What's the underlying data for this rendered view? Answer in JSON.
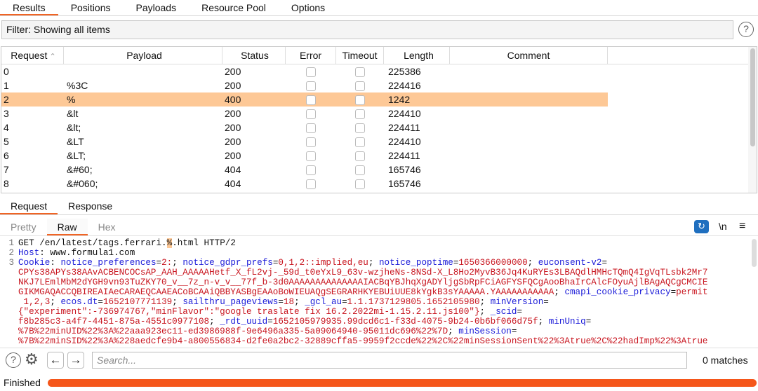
{
  "top_tabs": [
    "Results",
    "Positions",
    "Payloads",
    "Resource Pool",
    "Options"
  ],
  "filter": "Filter: Showing all items",
  "columns": [
    "Request",
    "Payload",
    "Status",
    "Error",
    "Timeout",
    "Length",
    "Comment"
  ],
  "rows": [
    {
      "request": "0",
      "payload": "",
      "status": "200",
      "error": false,
      "timeout": false,
      "length": "225386",
      "comment": ""
    },
    {
      "request": "1",
      "payload": "%3C",
      "status": "200",
      "error": false,
      "timeout": false,
      "length": "224416",
      "comment": ""
    },
    {
      "request": "2",
      "payload": "%",
      "status": "400",
      "error": false,
      "timeout": false,
      "length": "1242",
      "comment": "",
      "selected": true
    },
    {
      "request": "3",
      "payload": "&lt",
      "status": "200",
      "error": false,
      "timeout": false,
      "length": "224410",
      "comment": ""
    },
    {
      "request": "4",
      "payload": "&lt;",
      "status": "200",
      "error": false,
      "timeout": false,
      "length": "224411",
      "comment": ""
    },
    {
      "request": "5",
      "payload": "&LT",
      "status": "200",
      "error": false,
      "timeout": false,
      "length": "224410",
      "comment": ""
    },
    {
      "request": "6",
      "payload": "&LT;",
      "status": "200",
      "error": false,
      "timeout": false,
      "length": "224411",
      "comment": ""
    },
    {
      "request": "7",
      "payload": "&#60;",
      "status": "404",
      "error": false,
      "timeout": false,
      "length": "165746",
      "comment": ""
    },
    {
      "request": "8",
      "payload": "&#060;",
      "status": "404",
      "error": false,
      "timeout": false,
      "length": "165746",
      "comment": ""
    }
  ],
  "detail_tabs": [
    "Request",
    "Response"
  ],
  "view_tabs": [
    "Pretty",
    "Raw",
    "Hex"
  ],
  "toolbar": {
    "newline_label": "\\n",
    "wrap_icon": "wrap-lines-icon",
    "menu_icon": "hamburger-icon"
  },
  "code_lines": [
    {
      "n": "1",
      "segs": [
        [
          "p",
          "GET /en/latest/tags.ferrari."
        ],
        [
          "h",
          "%"
        ],
        [
          "p",
          ".html HTTP/2"
        ]
      ]
    },
    {
      "n": "2",
      "segs": [
        [
          "k",
          "Host"
        ],
        [
          "p",
          ": www.formula1.com"
        ]
      ]
    },
    {
      "n": "3",
      "segs": [
        [
          "k",
          "Cookie"
        ],
        [
          "p",
          ": "
        ],
        [
          "k",
          "notice_preferences"
        ],
        [
          "p",
          "="
        ],
        [
          "v",
          "2:"
        ],
        [
          "p",
          "; "
        ],
        [
          "k",
          "notice_gdpr_prefs"
        ],
        [
          "p",
          "="
        ],
        [
          "v",
          "0,1,2::implied,eu"
        ],
        [
          "p",
          "; "
        ],
        [
          "k",
          "notice_poptime"
        ],
        [
          "p",
          "="
        ],
        [
          "v",
          "1650366000000"
        ],
        [
          "p",
          "; "
        ],
        [
          "k",
          "euconsent-v2"
        ],
        [
          "p",
          "="
        ]
      ]
    },
    {
      "n": "",
      "segs": [
        [
          "v",
          "CPYs38APYs38AAvACBENCOCsAP_AAH_AAAAAHetf_X_fL2vj-_59d_t0eYxL9_63v-wzjheNs-8NSd-X_L8Ho2MyvB36Jq4KuRYEs3LBAQdlHMHcTQmQ4IgVqTLsbk2Mr7"
        ]
      ]
    },
    {
      "n": "",
      "segs": [
        [
          "v",
          "NKJ7LEmlMbM2dYGH9vn93TuZKY70_v__7z_n-v_v__77f_b-3d0AAAAAAAAAAAAAAIACBqYBJhqXgADYljgSbRpFCiAGFYSFQCgAooBhaIrCAlcFOyuAjlBAgAQCgCMCIE"
        ]
      ]
    },
    {
      "n": "",
      "segs": [
        [
          "v",
          "GIKMGAQACCQBIREAIAeCARAEQCAAEACoBCAAiQBBYASBgEAAoBoWIEUAQgSEGRARHKYEBUiUUE8kYgkB3sYAAAAA.YAAAAAAAAAAA"
        ],
        [
          "p",
          "; "
        ],
        [
          "k",
          "cmapi_cookie_privacy"
        ],
        [
          "p",
          "="
        ],
        [
          "v",
          "permit"
        ]
      ]
    },
    {
      "n": "",
      "segs": [
        [
          "v",
          " 1,2,3"
        ],
        [
          "p",
          "; "
        ],
        [
          "k",
          "ecos.dt"
        ],
        [
          "p",
          "="
        ],
        [
          "v",
          "1652107771139"
        ],
        [
          "p",
          "; "
        ],
        [
          "k",
          "sailthru_pageviews"
        ],
        [
          "p",
          "="
        ],
        [
          "v",
          "18"
        ],
        [
          "p",
          "; "
        ],
        [
          "k",
          "_gcl_au"
        ],
        [
          "p",
          "="
        ],
        [
          "v",
          "1.1.1737129805.1652105980"
        ],
        [
          "p",
          "; "
        ],
        [
          "k",
          "minVersion"
        ],
        [
          "p",
          "="
        ]
      ]
    },
    {
      "n": "",
      "segs": [
        [
          "v",
          "{\"experiment\":-736974767,\"minFlavor\":\"google traslate fix 16.2.2022mi-1.15.2.11.js100\"}"
        ],
        [
          "p",
          "; "
        ],
        [
          "k",
          "_scid"
        ],
        [
          "p",
          "="
        ]
      ]
    },
    {
      "n": "",
      "segs": [
        [
          "v",
          "f8b285c3-a4f7-4451-875a-4551c0977108"
        ],
        [
          "p",
          "; "
        ],
        [
          "k",
          "_rdt_uuid"
        ],
        [
          "p",
          "="
        ],
        [
          "v",
          "1652105979935.99dcd6c1-f33d-4075-9b24-0b6bf066d75f"
        ],
        [
          "p",
          "; "
        ],
        [
          "k",
          "minUniq"
        ],
        [
          "p",
          "="
        ]
      ]
    },
    {
      "n": "",
      "segs": [
        [
          "v",
          "%7B%22minUID%22%3A%22aaa923ec11-ed3986988f-9e6496a335-5a09064940-95011dc696%22%7D"
        ],
        [
          "p",
          "; "
        ],
        [
          "k",
          "minSession"
        ],
        [
          "p",
          "="
        ]
      ]
    },
    {
      "n": "",
      "segs": [
        [
          "v",
          "%7B%22minSID%22%3A%228aedcfe9b4-a800556834-d2fe0a2bc2-32889cffa5-9959f2ccde%22%2C%22minSessionSent%22%3Atrue%2C%22hadImp%22%3Atrue"
        ]
      ]
    }
  ],
  "search": {
    "placeholder": "Search...",
    "matches": "0 matches"
  },
  "status": {
    "text": "Finished",
    "progress_percent": 100
  },
  "colors": {
    "accent": "#f06424",
    "selected_row": "#fdc896",
    "key": "#1a1ad8",
    "value": "#c8141e",
    "progress": "#f5561a"
  }
}
